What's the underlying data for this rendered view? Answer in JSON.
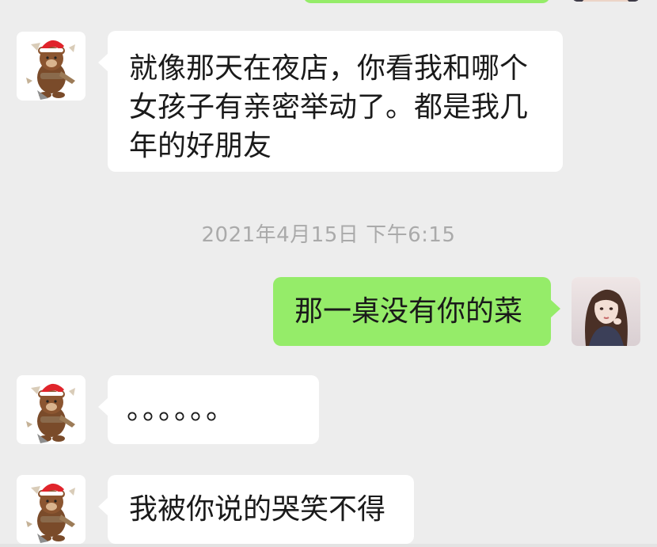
{
  "timestamp": "2021年4月15日 下午6:15",
  "messages": [
    {
      "side": "left",
      "text": "就像那天在夜店，你看我和哪个女孩子有亲密举动了。都是我几年的好朋友"
    },
    {
      "side": "right",
      "text": "那一桌没有你的菜"
    },
    {
      "side": "left",
      "text": "。。。。。。"
    },
    {
      "side": "left",
      "text": "我被你说的哭笑不得"
    }
  ],
  "colors": {
    "background": "#ededed",
    "incoming_bubble": "#ffffff",
    "outgoing_bubble": "#95ec69",
    "timestamp_text": "#aaaaaa"
  },
  "icons": {
    "contact_avatar": "brown-bear-santa-hat-avatar",
    "self_avatar": "girl-portrait-avatar"
  }
}
